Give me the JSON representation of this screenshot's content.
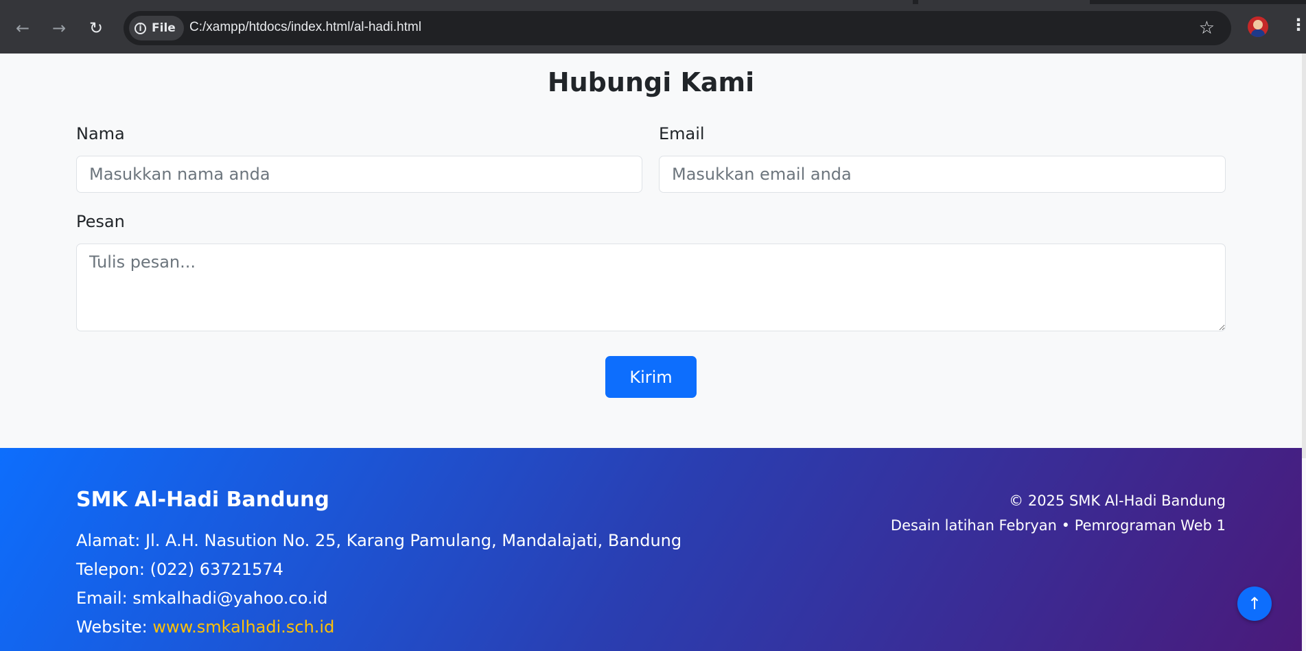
{
  "browser": {
    "site_chip_label": "File",
    "url": "C:/xampp/htdocs/index.html/al-hadi.html",
    "icons": {
      "back": "arrow-left-icon",
      "forward": "arrow-right-icon",
      "reload": "reload-icon",
      "info": "info-icon",
      "bookmark": "star-icon",
      "menu": "kebab-menu-icon"
    }
  },
  "contact": {
    "title": "Hubungi Kami",
    "name_label": "Nama",
    "name_placeholder": "Masukkan nama anda",
    "email_label": "Email",
    "email_placeholder": "Masukkan email anda",
    "message_label": "Pesan",
    "message_placeholder": "Tulis pesan...",
    "submit_label": "Kirim"
  },
  "footer": {
    "brand": "SMK Al-Hadi Bandung",
    "address": "Alamat: Jl. A.H. Nasution No. 25, Karang Pamulang, Mandalajati, Bandung",
    "phone": "Telepon: (022) 63721574",
    "email": "Email: smkalhadi@yahoo.co.id",
    "website_prefix": "Website: ",
    "website_link": "www.smkalhadi.sch.id",
    "copyright": "© 2025 SMK Al-Hadi Bandung",
    "credit": "Desain latihan Febryan • Pemrograman Web 1",
    "back_to_top_symbol": "↑"
  },
  "colors": {
    "primary": "#0d6efd",
    "link": "#ffc107",
    "footer_gradient_end": "#4a1a7a"
  }
}
